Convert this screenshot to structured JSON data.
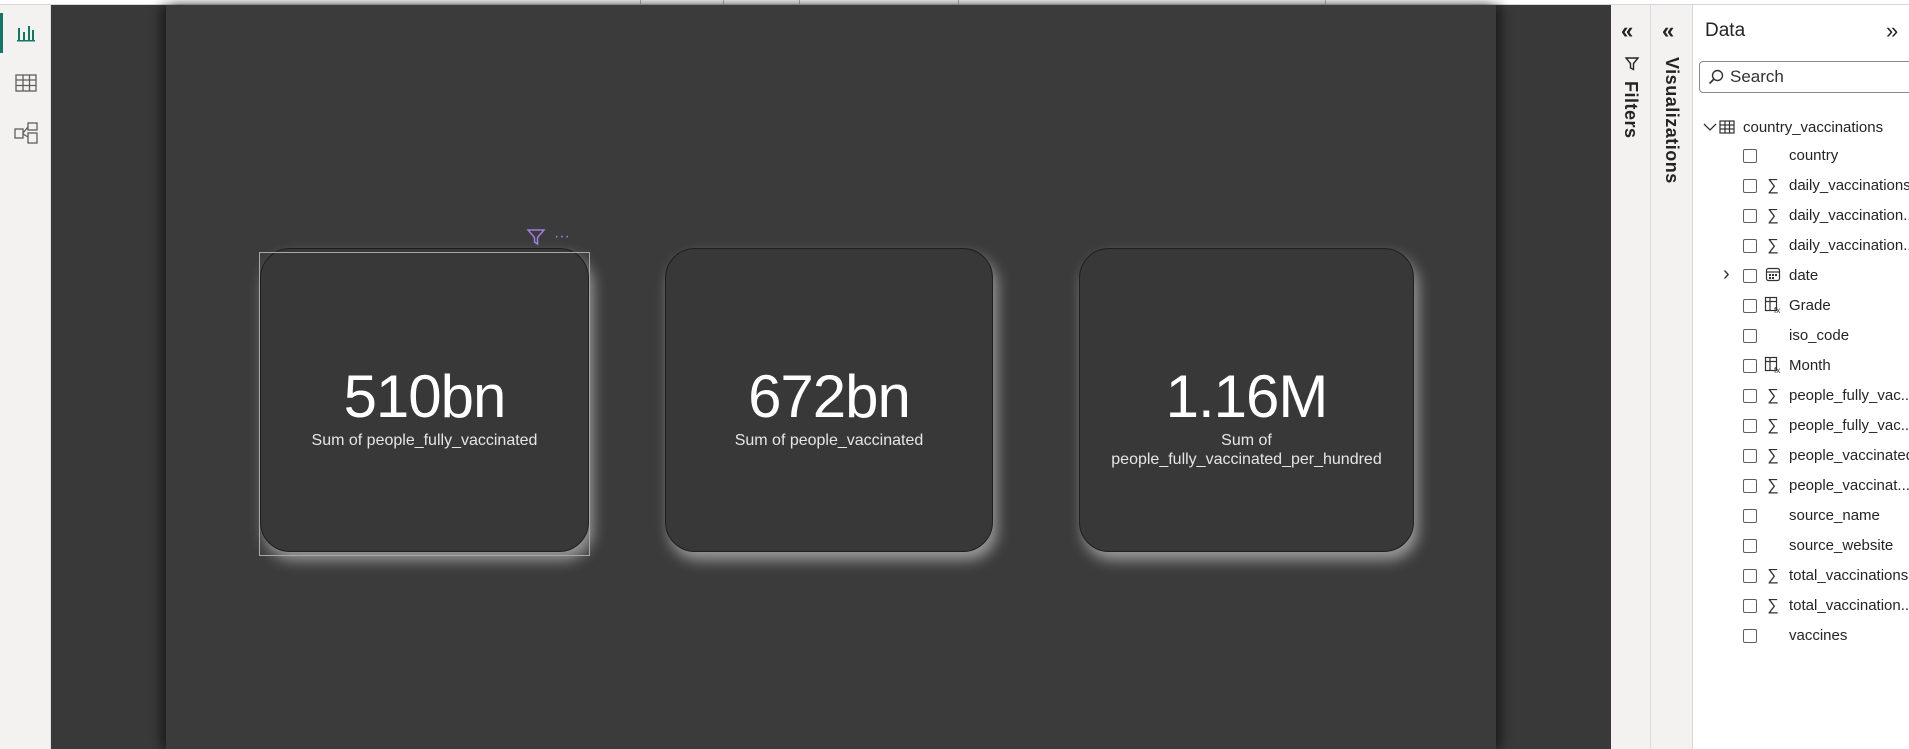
{
  "cards": [
    {
      "value": "510bn",
      "label": "Sum of people_fully_vaccinated"
    },
    {
      "value": "672bn",
      "label": "Sum of people_vaccinated"
    },
    {
      "value": "1.16M",
      "label": "Sum of people_fully_vaccinated_per_hundred"
    }
  ],
  "panes": {
    "filters_label": "Filters",
    "visualizations_label": "Visualizations",
    "data_title": "Data"
  },
  "search": {
    "placeholder": "Search"
  },
  "table": {
    "name": "country_vaccinations"
  },
  "fields": [
    {
      "name": "country",
      "icon": "none"
    },
    {
      "name": "daily_vaccinations",
      "icon": "sigma"
    },
    {
      "name": "daily_vaccination...",
      "icon": "sigma"
    },
    {
      "name": "daily_vaccination...",
      "icon": "sigma"
    },
    {
      "name": "date",
      "icon": "calendar",
      "expandable": true
    },
    {
      "name": "Grade",
      "icon": "calculated-column"
    },
    {
      "name": "iso_code",
      "icon": "none"
    },
    {
      "name": "Month",
      "icon": "calculated-column"
    },
    {
      "name": "people_fully_vac...",
      "icon": "sigma"
    },
    {
      "name": "people_fully_vac...",
      "icon": "sigma"
    },
    {
      "name": "people_vaccinated",
      "icon": "sigma"
    },
    {
      "name": "people_vaccinat...",
      "icon": "sigma"
    },
    {
      "name": "source_name",
      "icon": "none"
    },
    {
      "name": "source_website",
      "icon": "none"
    },
    {
      "name": "total_vaccinations",
      "icon": "sigma"
    },
    {
      "name": "total_vaccination...",
      "icon": "sigma"
    },
    {
      "name": "vaccines",
      "icon": "none"
    }
  ],
  "colors": {
    "canvas": "#393939",
    "accent": "#117865",
    "card_text": "#ffffff",
    "visual_header_icons": "#9f7fe0"
  }
}
